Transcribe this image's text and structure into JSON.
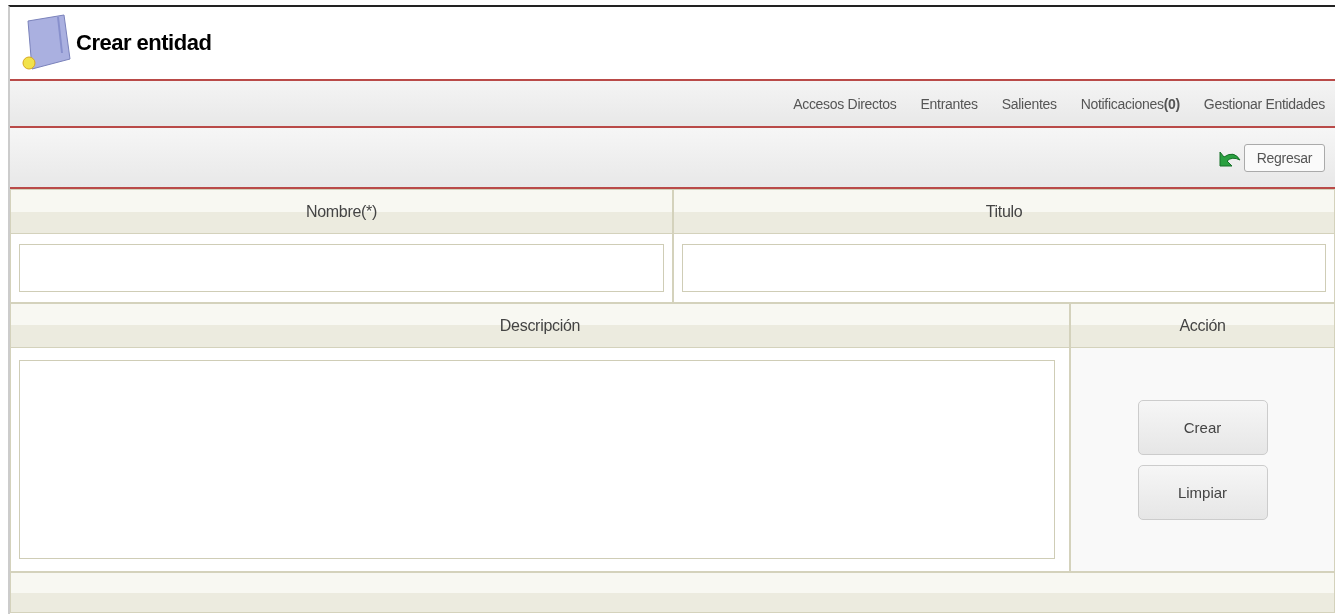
{
  "window": {
    "title": "Crear entidad"
  },
  "nav": [
    {
      "label": "Accesos Directos"
    },
    {
      "label": "Entrantes"
    },
    {
      "label": "Salientes"
    },
    {
      "label": "Notificaciones**(0)**"
    },
    {
      "label": "Gestionar Entidades"
    }
  ],
  "toolbar": {
    "back_button": "Regresar"
  },
  "form": {
    "row1": [
      {
        "heading": "Nombre(*)"
      },
      {
        "heading": "Titulo"
      }
    ],
    "description": {
      "heading": "Descripción"
    },
    "action": {
      "heading": "Acción",
      "buttons": [
        {
          "label": "Crear"
        },
        {
          "label": "Limpiar"
        }
      ]
    }
  }
}
